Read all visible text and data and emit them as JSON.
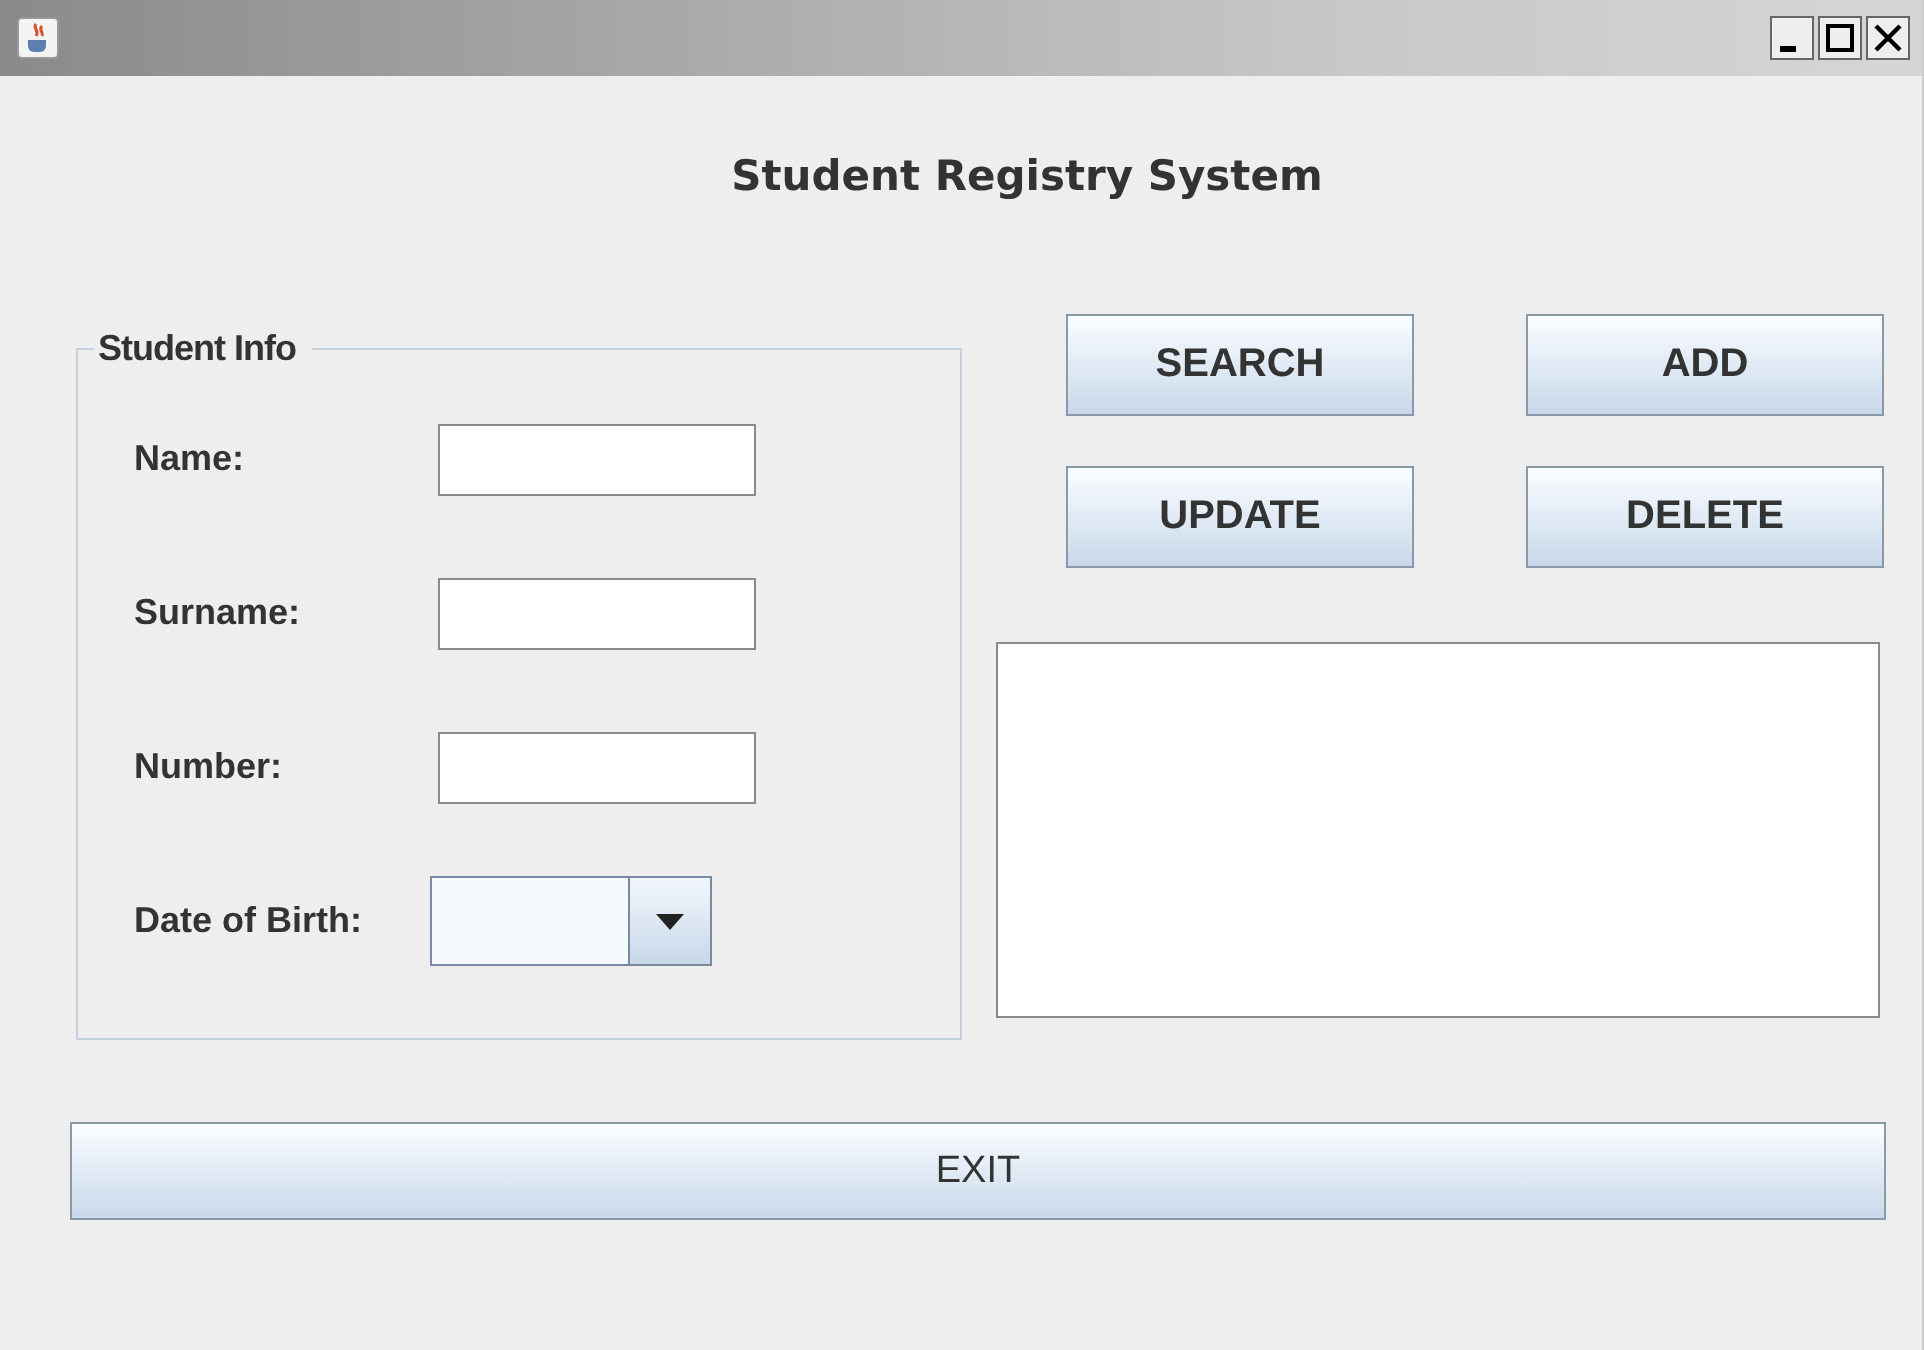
{
  "heading": "Student Registry System",
  "student_info": {
    "title": "Student Info",
    "fields": [
      {
        "label": "Name:",
        "kind": "text"
      },
      {
        "label": "Surname:",
        "kind": "text"
      },
      {
        "label": "Number:",
        "kind": "text"
      },
      {
        "label": "Date of Birth:",
        "kind": "combo"
      }
    ]
  },
  "buttons": [
    "SEARCH",
    "ADD",
    "UPDATE",
    "DELETE"
  ],
  "exit_button": "EXIT"
}
